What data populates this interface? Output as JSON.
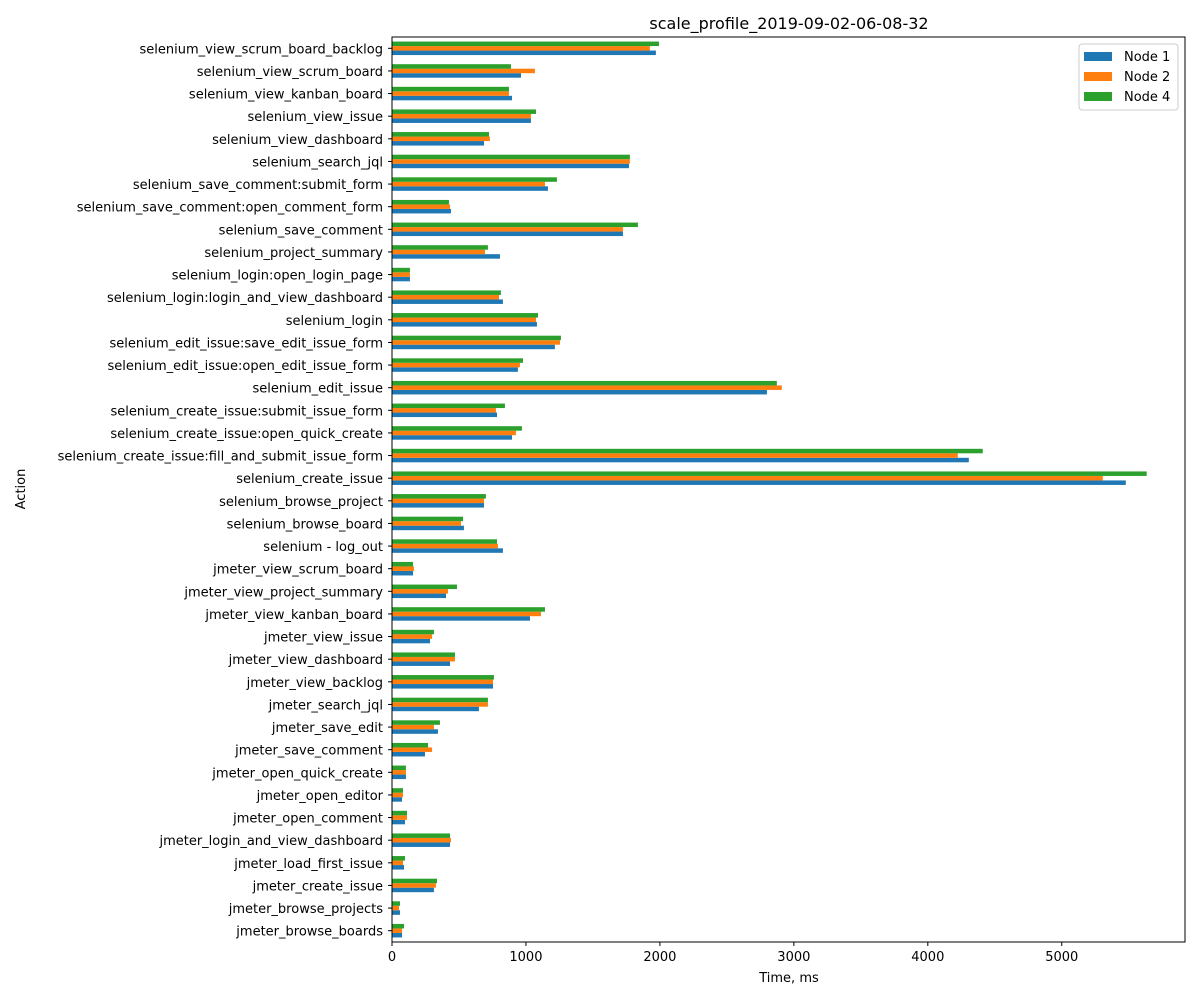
{
  "chart_data": {
    "type": "bar",
    "orientation": "horizontal",
    "title": "scale_profile_2019-09-02-06-08-32",
    "xlabel": "Time, ms",
    "ylabel": "Action",
    "xlim": [
      0,
      5920
    ],
    "xticks": [
      0,
      1000,
      2000,
      3000,
      4000,
      5000
    ],
    "grid": false,
    "legend_position": "top-right",
    "categories": [
      "selenium_view_scrum_board_backlog",
      "selenium_view_scrum_board",
      "selenium_view_kanban_board",
      "selenium_view_issue",
      "selenium_view_dashboard",
      "selenium_search_jql",
      "selenium_save_comment:submit_form",
      "selenium_save_comment:open_comment_form",
      "selenium_save_comment",
      "selenium_project_summary",
      "selenium_login:open_login_page",
      "selenium_login:login_and_view_dashboard",
      "selenium_login",
      "selenium_edit_issue:save_edit_issue_form",
      "selenium_edit_issue:open_edit_issue_form",
      "selenium_edit_issue",
      "selenium_create_issue:submit_issue_form",
      "selenium_create_issue:open_quick_create",
      "selenium_create_issue:fill_and_submit_issue_form",
      "selenium_create_issue",
      "selenium_browse_project",
      "selenium_browse_board",
      "selenium - log_out",
      "jmeter_view_scrum_board",
      "jmeter_view_project_summary",
      "jmeter_view_kanban_board",
      "jmeter_view_issue",
      "jmeter_view_dashboard",
      "jmeter_view_backlog",
      "jmeter_search_jql",
      "jmeter_save_edit",
      "jmeter_save_comment",
      "jmeter_open_quick_create",
      "jmeter_open_editor",
      "jmeter_open_comment",
      "jmeter_login_and_view_dashboard",
      "jmeter_load_first_issue",
      "jmeter_create_issue",
      "jmeter_browse_projects",
      "jmeter_browse_boards"
    ],
    "series": [
      {
        "name": "Node 1",
        "color": "#1f77b4",
        "values": [
          1970,
          963,
          896,
          1037,
          687,
          1769,
          1164,
          440,
          1724,
          806,
          134,
          828,
          1082,
          1216,
          940,
          2799,
          784,
          896,
          4306,
          5478,
          687,
          537,
          828,
          157,
          403,
          1030,
          284,
          433,
          754,
          649,
          343,
          246,
          104,
          75,
          97,
          433,
          90,
          313,
          60,
          75
        ]
      },
      {
        "name": "Node 2",
        "color": "#ff7f0e",
        "values": [
          1925,
          1067,
          873,
          1037,
          731,
          1776,
          1142,
          433,
          1724,
          694,
          134,
          799,
          1075,
          1254,
          955,
          2910,
          776,
          925,
          4224,
          5306,
          687,
          515,
          791,
          164,
          418,
          1112,
          299,
          470,
          754,
          716,
          313,
          299,
          104,
          82,
          112,
          440,
          82,
          328,
          52,
          75
        ]
      },
      {
        "name": "Node 4",
        "color": "#2ca02c",
        "values": [
          1993,
          888,
          873,
          1075,
          724,
          1776,
          1231,
          425,
          1836,
          716,
          134,
          813,
          1090,
          1261,
          978,
          2873,
          843,
          970,
          4410,
          5634,
          701,
          530,
          784,
          157,
          485,
          1142,
          313,
          470,
          761,
          716,
          358,
          269,
          104,
          82,
          112,
          433,
          97,
          336,
          60,
          90
        ]
      }
    ]
  }
}
